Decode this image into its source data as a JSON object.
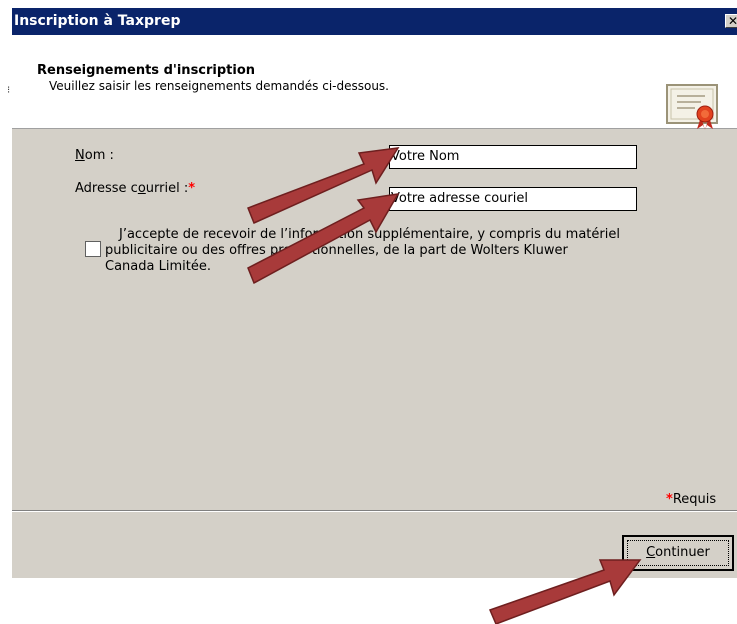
{
  "dialog": {
    "title": "Inscription à Taxprep",
    "close_glyph": "✕",
    "header_title": "Renseignements d'inscription",
    "header_subtitle": "Veuillez saisir les renseignements demandés ci-dessous.",
    "header_icon": "certificate-icon"
  },
  "form": {
    "name_label_first": "N",
    "name_label_rest": "om :",
    "name_value": "Votre Nom",
    "email_label_start": "Adresse c",
    "email_label_under": "o",
    "email_label_end": "urriel :",
    "required_marker": "*",
    "email_value": "Votre adresse couriel",
    "consent_line1": "J’accepte de recevoir de l’information supplémentaire, y compris du matériel",
    "consent_line2": "publicitaire ou des offres promotionnelles, de la part de Wolters Kluwer",
    "consent_line3": "Canada Limitée.",
    "consent_checked": false
  },
  "footer": {
    "required_star": "*",
    "required_label": "Requis",
    "continue_first": "C",
    "continue_rest": "ontinuer"
  },
  "overlay": {
    "arrow_color": "#a83a3a",
    "arrow_count": 3
  },
  "side_mark": "⁝"
}
